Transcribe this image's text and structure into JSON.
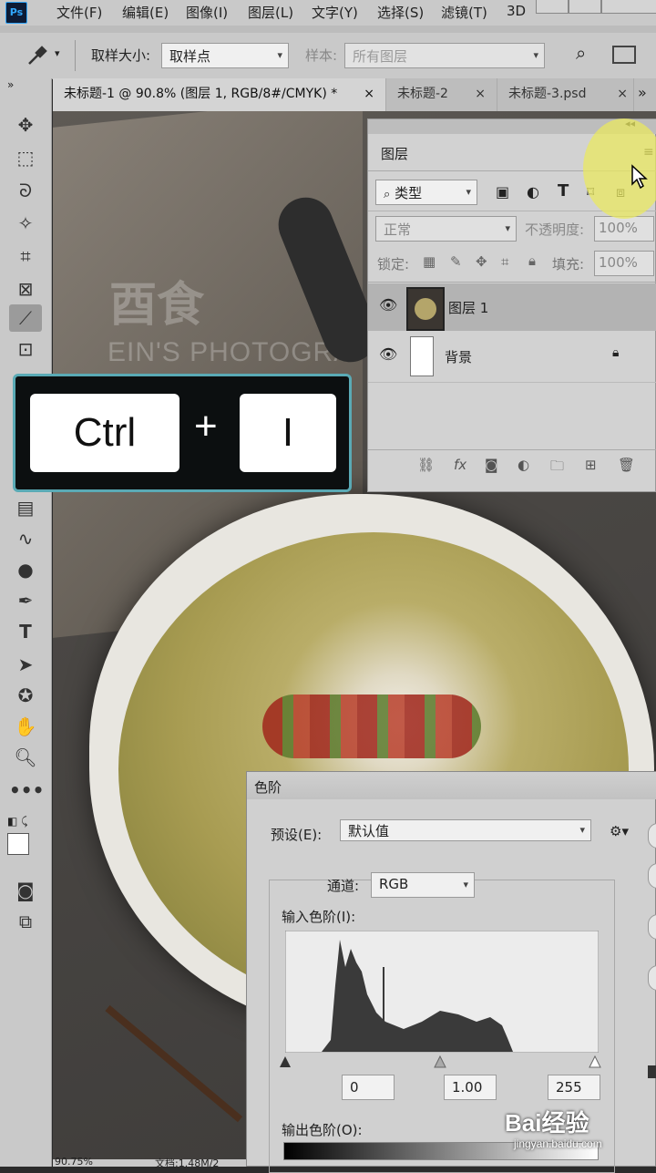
{
  "app": {
    "logo": "Ps"
  },
  "menu": [
    "文件(F)",
    "编辑(E)",
    "图像(I)",
    "图层(L)",
    "文字(Y)",
    "选择(S)",
    "滤镜(T)",
    "3D"
  ],
  "options": {
    "sample_size_label": "取样大小:",
    "sample_size_value": "取样点",
    "sample_label": "样本:",
    "sample_value": "所有图层"
  },
  "tabs": [
    {
      "label": "未标题-1 @ 90.8% (图层 1, RGB/8#/CMYK) *",
      "close": "×"
    },
    {
      "label": "未标题-2",
      "close": "×"
    },
    {
      "label": "未标题-3.psd",
      "close": "×"
    }
  ],
  "tab_overflow": "»",
  "layers_panel": {
    "title": "图层",
    "filter_label": "类型",
    "blend_mode": "正常",
    "opacity_label": "不透明度:",
    "opacity_value": "100%",
    "lock_label": "锁定:",
    "fill_label": "填充:",
    "fill_value": "100%",
    "layers": [
      {
        "name": "图层 1",
        "selected": true
      },
      {
        "name": "背景",
        "locked": true
      }
    ]
  },
  "shortcut": {
    "key1": "Ctrl",
    "plus": "+",
    "key2": "I"
  },
  "canvas": {
    "watermark_title": "酉食",
    "watermark_sub": "EIN'S PHOTOGRA"
  },
  "levels": {
    "title": "色阶",
    "preset_label": "预设(E):",
    "preset_value": "默认值",
    "channel_label": "通道:",
    "channel_value": "RGB",
    "input_label": "输入色阶(I):",
    "input_black": "0",
    "input_gamma": "1.00",
    "input_white": "255",
    "output_label": "输出色阶(O):"
  },
  "status": {
    "zoom": "90.75%",
    "doc": "文档:1.48M/2"
  },
  "watermark": {
    "brand": "Bai经验",
    "url": "jingyan.baidu.com"
  },
  "colors": {
    "accent": "#31a8ff",
    "overlay_border": "#5aaab5",
    "highlight": "#e9e860"
  }
}
